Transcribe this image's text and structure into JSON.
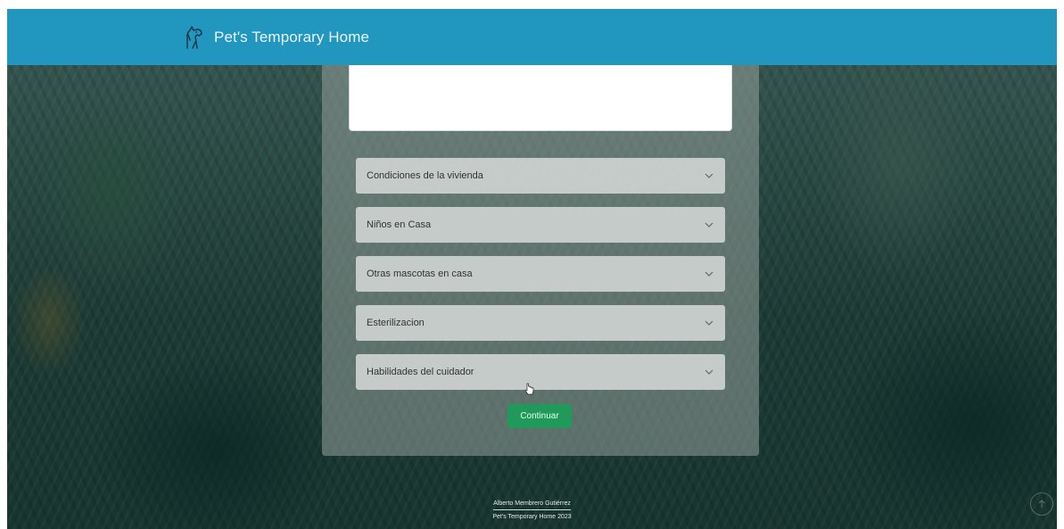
{
  "navbar": {
    "brand_icon": "dog-outline-icon",
    "brand_text": "Pet's Temporary Home",
    "color": "#2196bf"
  },
  "form": {
    "description_value": "",
    "accordions": [
      {
        "label": "Condiciones de la vivienda"
      },
      {
        "label": "Niños en Casa"
      },
      {
        "label": "Otras mascotas en casa"
      },
      {
        "label": "Esterilizacion"
      },
      {
        "label": "Habilidades del cuidador"
      }
    ],
    "continue_label": "Continuar",
    "continue_color": "#1f9a5a"
  },
  "footer": {
    "author": "Alberto Membrero Gutiérrez",
    "copyright": "Pet's Temporary Home 2023"
  },
  "floating": {
    "scroll_icon": "arrow-up-circle-icon"
  }
}
